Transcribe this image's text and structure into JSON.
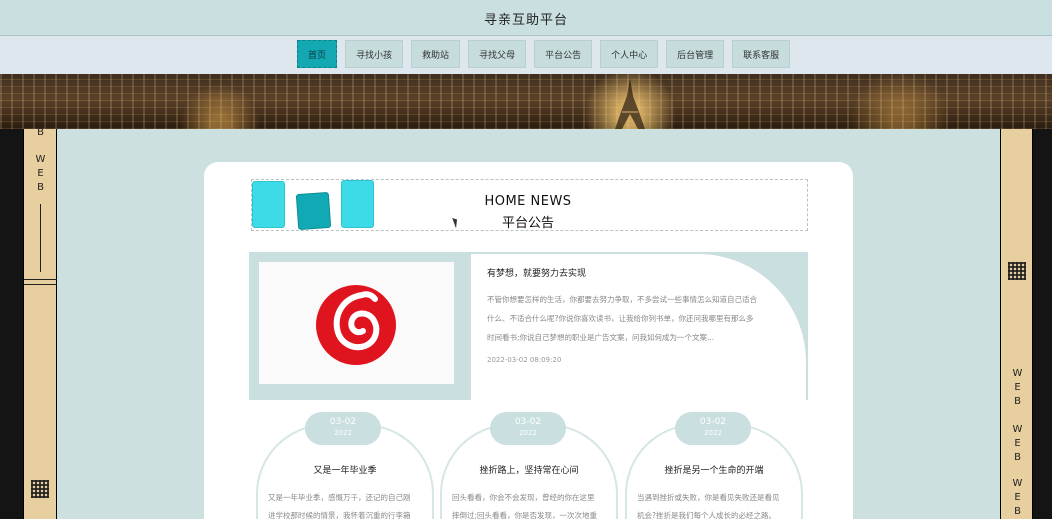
{
  "header": {
    "title": "寻亲互助平台"
  },
  "nav": {
    "items": [
      {
        "label": "首页",
        "active": true
      },
      {
        "label": "寻找小孩",
        "active": false
      },
      {
        "label": "救助站",
        "active": false
      },
      {
        "label": "寻找父母",
        "active": false
      },
      {
        "label": "平台公告",
        "active": false
      },
      {
        "label": "个人中心",
        "active": false
      },
      {
        "label": "后台管理",
        "active": false
      },
      {
        "label": "联系客服",
        "active": false
      }
    ]
  },
  "sidebar": {
    "left_text": [
      "B",
      "W",
      "E",
      "B"
    ],
    "right_text": [
      "W",
      "E",
      "B",
      "W",
      "E",
      "B",
      "W",
      "E",
      "B"
    ]
  },
  "news": {
    "heading_en": "HOME NEWS",
    "heading_cn": "平台公告",
    "featured": {
      "title": "有梦想，就要努力去实现",
      "body": "不管你想要怎样的生活，你都要去努力争取，不多尝试一些事情怎么知道自己适合什么、不适合什么呢?你说你喜欢读书，让我给你列书单，你还问我哪里有那么多时间看书;你说自己梦想的职业是广告文案，问我如何成为一个文案...",
      "date": "2022-03-02 08:09:20",
      "image_icon": "netease-music-logo-icon"
    },
    "cards": [
      {
        "month_day": "03-02",
        "year": "2022",
        "title": "又是一年毕业季",
        "body": "又是一年毕业季，感慨万千，还记的自己刚进学校那时候的情景，我怀着沉重的行李箱"
      },
      {
        "month_day": "03-02",
        "year": "2022",
        "title": "挫折路上，坚持常在心间",
        "body": "回头看看，你会不会发现，曾经的你在这里摔倒过;回头看看，你是否发现，一次次地重"
      },
      {
        "month_day": "03-02",
        "year": "2022",
        "title": "挫折是另一个生命的开端",
        "body": "当遇到挫折或失败，你是看见失败还是看见机会?挫折是我们每个人成长的必经之路。"
      }
    ]
  },
  "colors": {
    "accent": "#13a8b2",
    "panel": "#c9dfe0",
    "strip": "#e8cfa0"
  }
}
